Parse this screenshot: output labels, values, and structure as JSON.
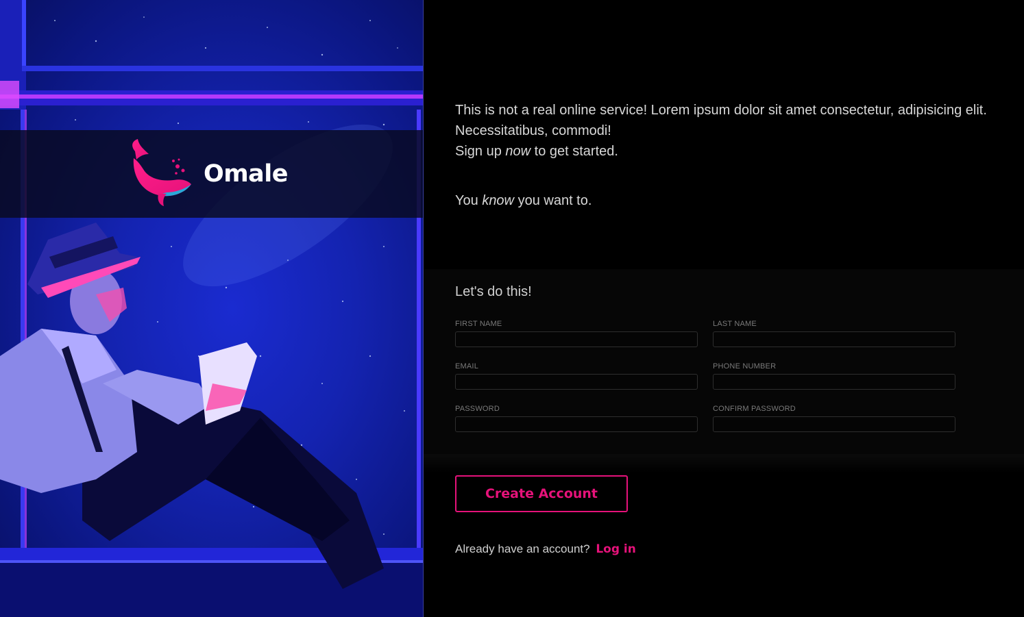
{
  "brand": {
    "name": "Omale",
    "logo_icon": "whale-icon"
  },
  "intro": {
    "line1": "This is not a real online service! Lorem ipsum dolor sit amet consectetur, adipisicing elit. Necessitatibus, commodi!",
    "line2_prefix": "Sign up ",
    "line2_emphasis": "now",
    "line2_suffix": " to get started.",
    "line3_prefix": "You ",
    "line3_emphasis": "know",
    "line3_suffix": " you want to."
  },
  "form": {
    "title": "Let's do this!",
    "fields": {
      "first_name": {
        "label": "FIRST NAME",
        "value": ""
      },
      "last_name": {
        "label": "LAST NAME",
        "value": ""
      },
      "email": {
        "label": "EMAIL",
        "value": ""
      },
      "phone": {
        "label": "PHONE NUMBER",
        "value": ""
      },
      "password": {
        "label": "PASSWORD",
        "value": ""
      },
      "confirm_password": {
        "label": "CONFIRM PASSWORD",
        "value": ""
      }
    }
  },
  "actions": {
    "create_label": "Create Account",
    "login_prompt": "Already have an account?",
    "login_label": "Log in"
  },
  "colors": {
    "accent": "#e6127a",
    "background": "#000000",
    "hero_blue": "#1423b0"
  }
}
